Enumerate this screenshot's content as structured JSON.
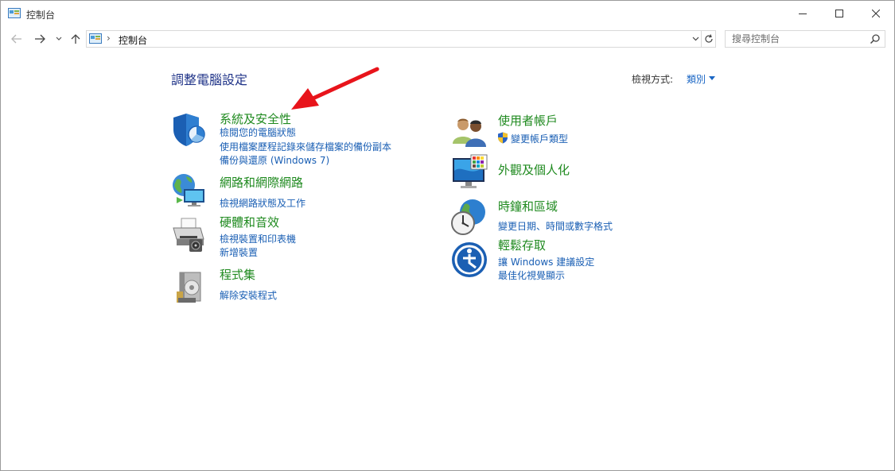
{
  "window": {
    "title": "控制台",
    "minimize_icon": "minimize-icon",
    "maximize_icon": "maximize-icon",
    "close_icon": "close-icon"
  },
  "nav": {
    "address_path": "控制台",
    "address_separator": "›",
    "search_placeholder": "搜尋控制台"
  },
  "header": {
    "title": "調整電腦設定",
    "view_by_label": "檢視方式:",
    "view_by_value": "類別"
  },
  "categories": {
    "security": {
      "title": "系統及安全性",
      "icon": "shield-icon",
      "links": [
        "檢閱您的電腦狀態",
        "使用檔案歷程記錄來儲存檔案的備份副本",
        "備份與還原 (Windows 7)"
      ]
    },
    "network": {
      "title": "網路和網際網路",
      "icon": "network-globe-icon",
      "links": [
        "檢視網路狀態及工作"
      ]
    },
    "hardware": {
      "title": "硬體和音效",
      "icon": "printer-icon",
      "links": [
        "檢視裝置和印表機",
        "新增裝置"
      ]
    },
    "programs": {
      "title": "程式集",
      "icon": "programs-disc-icon",
      "links": [
        "解除安裝程式"
      ]
    },
    "users": {
      "title": "使用者帳戶",
      "icon": "users-icon",
      "links": [
        "變更帳戶類型"
      ]
    },
    "appearance": {
      "title": "外觀及個人化",
      "icon": "monitor-palette-icon",
      "links": []
    },
    "clock": {
      "title": "時鐘和區域",
      "icon": "clock-globe-icon",
      "links": [
        "變更日期、時間或數字格式"
      ]
    },
    "ease": {
      "title": "輕鬆存取",
      "icon": "ease-of-access-icon",
      "links": [
        "讓 Windows 建議設定",
        "最佳化視覺顯示"
      ]
    }
  },
  "colors": {
    "category_title": "#1f8a1f",
    "link": "#1a5fb4",
    "page_title": "#1e3287",
    "annotation_arrow": "#e8141b"
  }
}
